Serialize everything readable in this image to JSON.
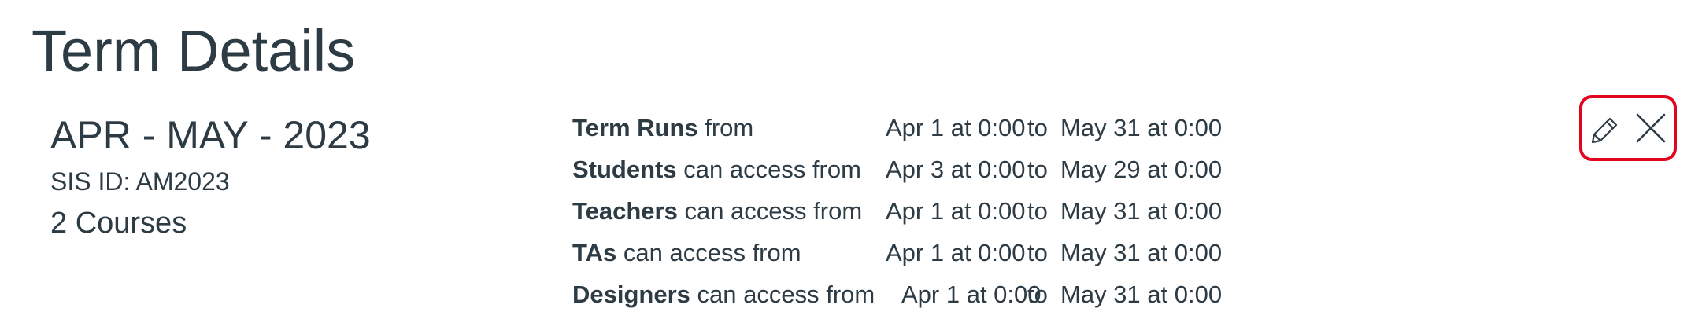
{
  "page_title": "Term Details",
  "term": {
    "name": "APR - MAY - 2023",
    "sis_id": "SIS ID: AM2023",
    "courses": "2 Courses"
  },
  "date_rows": [
    {
      "role": "Term Runs",
      "suffix": " from",
      "start": "Apr 1 at 0:00",
      "to": "to",
      "end": "May 31 at 0:00"
    },
    {
      "role": "Students",
      "suffix": " can access from",
      "start": "Apr 3 at 0:00",
      "to": "to",
      "end": "May 29 at 0:00"
    },
    {
      "role": "Teachers",
      "suffix": " can access from",
      "start": "Apr 1 at 0:00",
      "to": "to",
      "end": "May 31 at 0:00"
    },
    {
      "role": "TAs",
      "suffix": " can access from",
      "start": "Apr 1 at 0:00",
      "to": "to",
      "end": "May 31 at 0:00"
    },
    {
      "role": "Designers",
      "suffix": " can access from",
      "start": "Apr 1 at 0:00",
      "to": "to",
      "end": "May 31 at 0:00"
    }
  ],
  "actions": {
    "edit_icon": "pencil-icon",
    "delete_icon": "close-icon",
    "highlight_color": "#e0061f"
  }
}
